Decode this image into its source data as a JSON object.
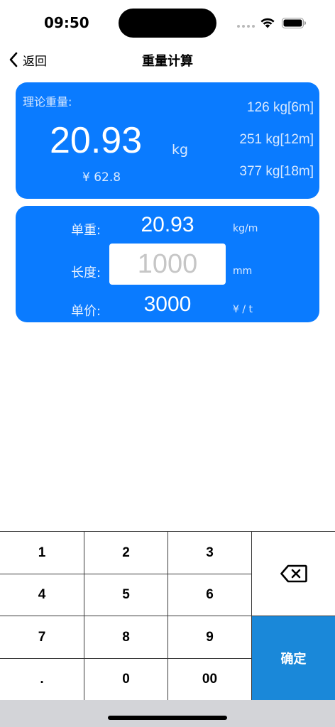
{
  "status_bar": {
    "time": "09:50"
  },
  "nav": {
    "back_label": "返回",
    "title": "重量计算"
  },
  "result": {
    "label": "理论重量:",
    "value": "20.93",
    "unit": "kg",
    "price": "¥  62.8",
    "weights": [
      "126 kg[6m]",
      "251 kg[12m]",
      "377 kg[18m]"
    ]
  },
  "inputs": {
    "unit_weight": {
      "label": "单重:",
      "value": "20.93",
      "unit": "kg/m"
    },
    "length": {
      "label": "长度:",
      "placeholder": "1000",
      "unit": "mm"
    },
    "unit_price": {
      "label": "单价:",
      "value": "3000",
      "unit": "¥ / t"
    }
  },
  "keypad": {
    "keys": [
      "1",
      "2",
      "3",
      "4",
      "5",
      "6",
      "7",
      "8",
      "9",
      ".",
      "0",
      "00"
    ],
    "delete_icon": "delete-backspace-icon",
    "confirm_label": "确定"
  },
  "colors": {
    "card_blue": "#0a7bff",
    "confirm_blue": "#1a88d9"
  }
}
